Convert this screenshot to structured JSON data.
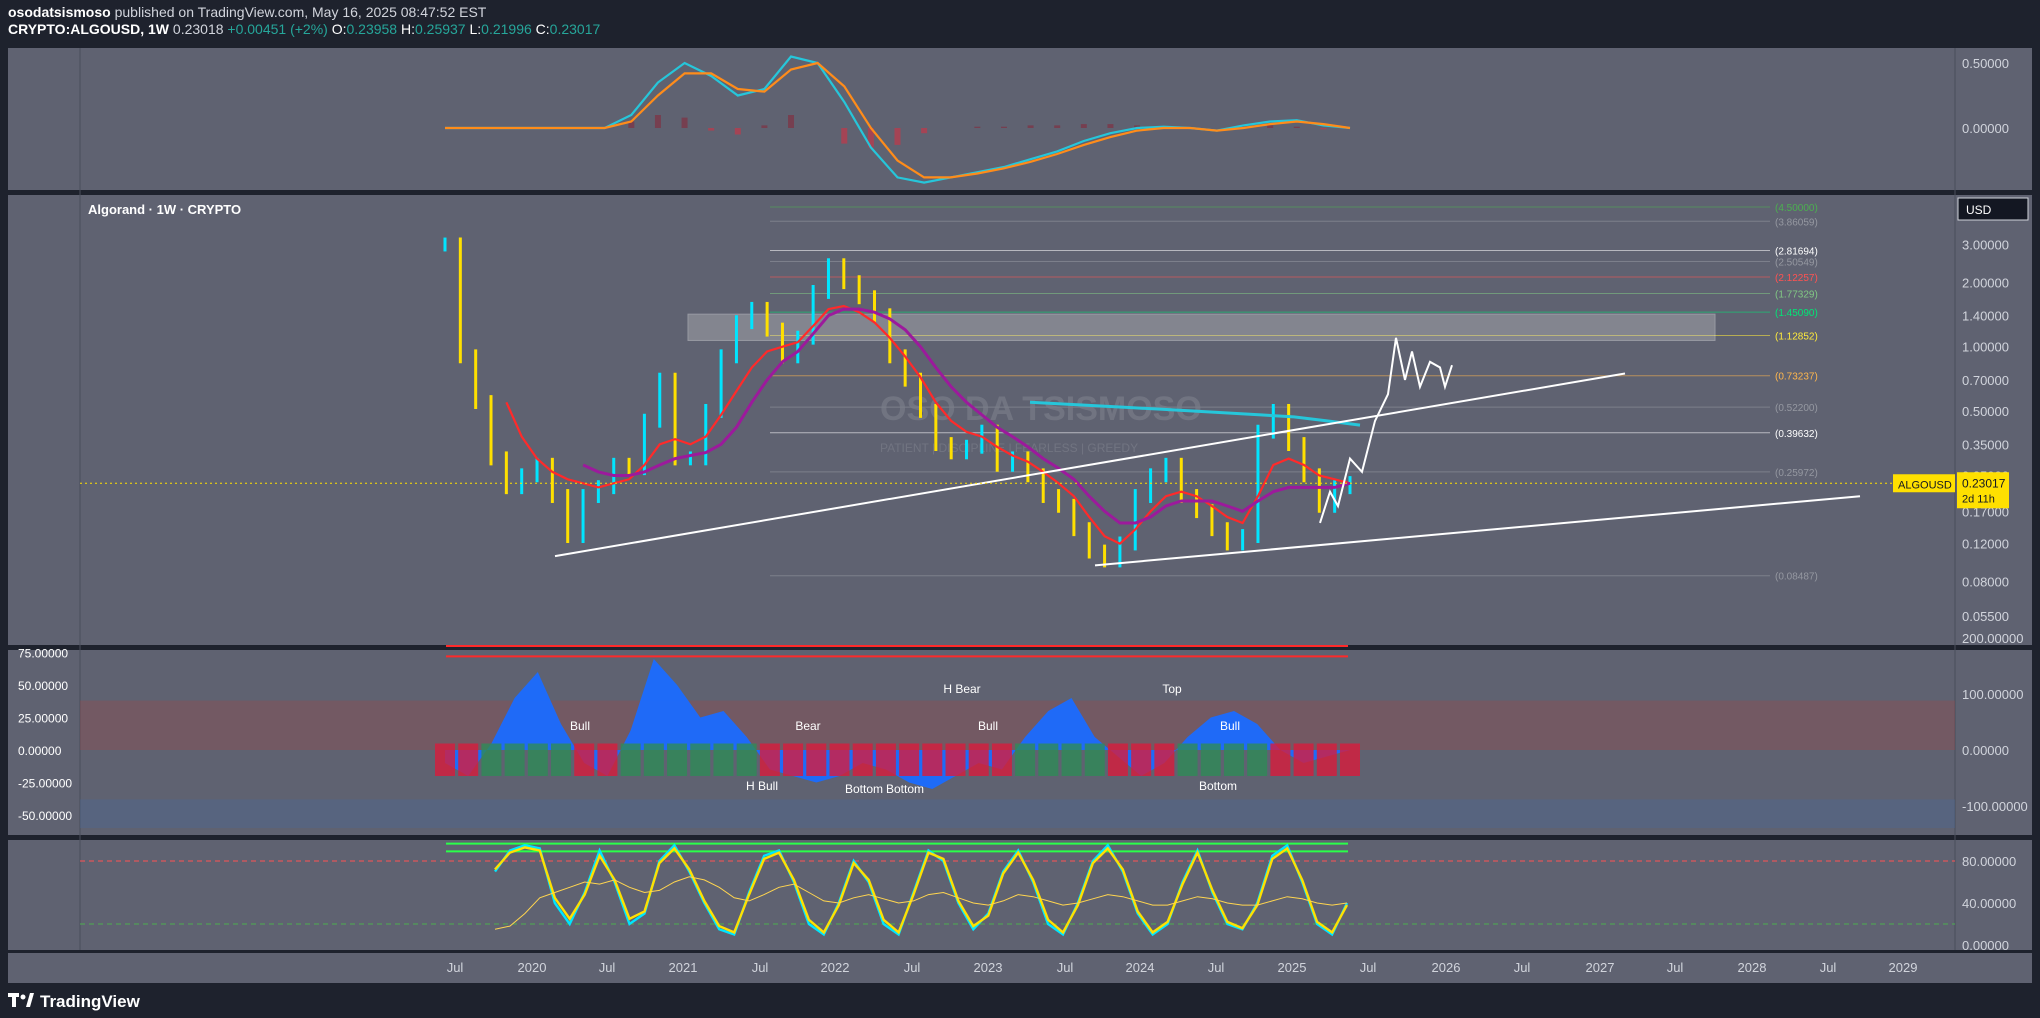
{
  "header": {
    "publisher": "osodatsismoso",
    "published_text": "published on TradingView.com, May 16, 2025 08:47:52 EST",
    "symbol_line": "CRYPTO:ALGOUSD, 1W",
    "last": "0.23018",
    "change": "+0.00451 (+2%)",
    "o_label": "O:",
    "o_value": "0.23958",
    "h_label": "H:",
    "h_value": "0.25937",
    "l_label": "L:",
    "l_value": "0.21996",
    "c_label": "C:",
    "c_value": "0.23017"
  },
  "footer": {
    "brand": "TradingView"
  },
  "colors": {
    "background": "#5f6271",
    "panel_border": "#1e222d",
    "price_up": "#00e5ff",
    "price_down": "#ffe000",
    "ema_red": "#ff2a2a",
    "ema_purple": "#9c1a9c",
    "macd_cyan": "#26c6da",
    "macd_orange": "#ff8c1a",
    "trendline": "#ffffff",
    "tag": "#ffe000"
  },
  "chart_data": [
    {
      "type": "line",
      "panel": "macd",
      "y_ticks": [
        "0.50000",
        "0.00000"
      ],
      "series": [
        {
          "color": "#26c6da",
          "values": [
            0,
            0,
            0,
            0,
            0,
            0,
            0,
            0.1,
            0.35,
            0.5,
            0.4,
            0.25,
            0.3,
            0.55,
            0.5,
            0.2,
            -0.15,
            -0.38,
            -0.42,
            -0.38,
            -0.34,
            -0.3,
            -0.24,
            -0.18,
            -0.1,
            -0.04,
            0,
            0.01,
            0.0,
            -0.02,
            0.02,
            0.05,
            0.06,
            0.02,
            0.0
          ]
        },
        {
          "color": "#ff8c1a",
          "values": [
            0,
            0,
            0,
            0,
            0,
            0,
            0,
            0.05,
            0.25,
            0.42,
            0.42,
            0.3,
            0.28,
            0.45,
            0.5,
            0.32,
            0.0,
            -0.25,
            -0.38,
            -0.38,
            -0.35,
            -0.31,
            -0.26,
            -0.2,
            -0.13,
            -0.07,
            -0.02,
            0.0,
            0.0,
            -0.02,
            0.0,
            0.03,
            0.05,
            0.03,
            0.0
          ]
        }
      ]
    },
    {
      "type": "line",
      "panel": "price",
      "title": "Algorand · 1W · CRYPTO",
      "y_scale": "log",
      "y_ticks": [
        "3.00000",
        "2.00000",
        "1.40000",
        "1.00000",
        "0.70000",
        "0.50000",
        "0.35000",
        "0.25000",
        "0.17000",
        "0.12000",
        "0.08000",
        "0.05500"
      ],
      "x_ticks": [
        "Jul",
        "2020",
        "Jul",
        "2021",
        "Jul",
        "2022",
        "Jul",
        "2023",
        "Jul",
        "2024",
        "Jul",
        "2025",
        "Jul",
        "2026",
        "Jul",
        "2027",
        "Jul",
        "2028",
        "Jul",
        "2029"
      ],
      "currency": "USD",
      "last_price_tag": {
        "symbol": "ALGOUSD",
        "value": "0.23017",
        "countdown": "2d 11h"
      },
      "fib_levels": [
        {
          "label": "(4.50000)",
          "value": 4.5,
          "color": "#4caf50"
        },
        {
          "label": "(3.86059)",
          "value": 3.86,
          "color": "#9598a1"
        },
        {
          "label": "(2.81694)",
          "value": 2.817,
          "color": "#ffffff"
        },
        {
          "label": "(2.50549)",
          "value": 2.505,
          "color": "#9598a1"
        },
        {
          "label": "(2.12257)",
          "value": 2.12,
          "color": "#ff5252"
        },
        {
          "label": "(1.77329)",
          "value": 1.773,
          "color": "#81c784"
        },
        {
          "label": "(1.45090)",
          "value": 1.451,
          "color": "#00e676"
        },
        {
          "label": "(1.12852)",
          "value": 1.1285,
          "color": "#ffeb3b"
        },
        {
          "label": "(0.73237)",
          "value": 0.732,
          "color": "#ffb74d"
        },
        {
          "label": "(0.52200)",
          "value": 0.522,
          "color": "#9598a1"
        },
        {
          "label": "(0.39632)",
          "value": 0.396,
          "color": "#ffffff"
        },
        {
          "label": "(0.25972)",
          "value": 0.26,
          "color": "#9598a1"
        },
        {
          "label": "(0.08487)",
          "value": 0.085,
          "color": "#9598a1"
        }
      ],
      "resistance_zone": {
        "low": 1.07,
        "high": 1.42
      },
      "watermark": "OSO DA TSISMOSO",
      "watermark_sub": "PATIENT | DISCIPLINE | FEARLESS | GREEDY",
      "series": [
        {
          "name": "",
          "kind": "price",
          "values": [
            3.0,
            0.9,
            0.55,
            0.3,
            0.22,
            0.25,
            0.28,
            0.2,
            0.13,
            0.2,
            0.22,
            0.28,
            0.27,
            0.45,
            0.7,
            0.3,
            0.3,
            0.5,
            0.9,
            1.3,
            1.5,
            1.2,
            0.9,
            1.1,
            1.8,
            2.4,
            2.0,
            1.7,
            1.4,
            0.9,
            0.7,
            0.5,
            0.35,
            0.32,
            0.34,
            0.4,
            0.28,
            0.3,
            0.25,
            0.2,
            0.18,
            0.14,
            0.11,
            0.1,
            0.12,
            0.2,
            0.25,
            0.28,
            0.2,
            0.17,
            0.14,
            0.12,
            0.13,
            0.4,
            0.5,
            0.35,
            0.25,
            0.18,
            0.22,
            0.23
          ]
        },
        {
          "name": "",
          "kind": "ema_red",
          "values": [
            null,
            null,
            null,
            null,
            0.55,
            0.38,
            0.3,
            0.26,
            0.24,
            0.23,
            0.22,
            0.23,
            0.24,
            0.28,
            0.35,
            0.37,
            0.35,
            0.38,
            0.48,
            0.62,
            0.8,
            0.95,
            1.0,
            1.05,
            1.25,
            1.5,
            1.55,
            1.45,
            1.3,
            1.1,
            0.9,
            0.72,
            0.55,
            0.45,
            0.4,
            0.38,
            0.34,
            0.31,
            0.29,
            0.26,
            0.23,
            0.2,
            0.16,
            0.13,
            0.12,
            0.14,
            0.17,
            0.2,
            0.21,
            0.2,
            0.18,
            0.16,
            0.15,
            0.2,
            0.28,
            0.3,
            0.28,
            0.25,
            0.24,
            0.23
          ]
        },
        {
          "name": "",
          "kind": "ema_purple",
          "values": [
            null,
            null,
            null,
            null,
            null,
            null,
            null,
            null,
            null,
            0.28,
            0.26,
            0.25,
            0.25,
            0.26,
            0.28,
            0.3,
            0.31,
            0.32,
            0.35,
            0.42,
            0.55,
            0.7,
            0.85,
            0.95,
            1.15,
            1.4,
            1.5,
            1.5,
            1.45,
            1.35,
            1.2,
            1.0,
            0.8,
            0.65,
            0.55,
            0.48,
            0.42,
            0.38,
            0.34,
            0.3,
            0.27,
            0.24,
            0.2,
            0.17,
            0.15,
            0.15,
            0.16,
            0.18,
            0.19,
            0.19,
            0.19,
            0.18,
            0.17,
            0.19,
            0.21,
            0.22,
            0.22,
            0.22,
            0.22,
            0.23
          ]
        },
        {
          "name": "",
          "kind": "ema_cyan",
          "values": [
            0.55,
            0.54,
            0.53,
            0.52,
            0.51,
            0.5,
            0.49,
            0.48,
            0.47,
            0.45,
            0.43
          ]
        }
      ]
    },
    {
      "type": "area",
      "panel": "oscillator",
      "y_ticks_left": [
        "75.00000",
        "50.00000",
        "25.00000",
        "0.00000",
        "-25.00000",
        "-50.00000"
      ],
      "y_ticks_right": [
        "200.00000",
        "100.00000",
        "0.00000",
        "-100.00000"
      ],
      "labels": [
        "Bull",
        "H Bull",
        "Bear",
        "Bottom",
        "Bottom",
        "H Bear",
        "Bull",
        "Top",
        "Bull",
        "Bottom"
      ],
      "values": [
        -10,
        -20,
        5,
        40,
        60,
        20,
        -10,
        -20,
        15,
        70,
        50,
        25,
        30,
        10,
        -15,
        -20,
        -25,
        -20,
        -10,
        -15,
        -25,
        -30,
        -20,
        -10,
        -15,
        10,
        30,
        40,
        10,
        -5,
        -20,
        -10,
        10,
        25,
        30,
        20,
        0,
        -10,
        -5,
        0
      ]
    },
    {
      "type": "line",
      "panel": "stoch_rsi",
      "y_ticks": [
        "80.00000",
        "40.00000",
        "0.00000"
      ],
      "levels": [
        80,
        20
      ],
      "series": [
        {
          "color": "#00e5ff",
          "values": [
            70,
            90,
            95,
            92,
            40,
            20,
            50,
            90,
            60,
            20,
            30,
            80,
            95,
            70,
            40,
            15,
            10,
            50,
            85,
            90,
            60,
            20,
            10,
            40,
            80,
            60,
            20,
            10,
            50,
            90,
            80,
            40,
            15,
            30,
            70,
            90,
            60,
            20,
            10,
            40,
            80,
            95,
            70,
            30,
            10,
            20,
            60,
            90,
            50,
            20,
            15,
            40,
            85,
            95,
            60,
            20,
            10,
            40
          ]
        },
        {
          "color": "#ffe000",
          "values": [
            72,
            88,
            93,
            90,
            45,
            25,
            48,
            85,
            62,
            25,
            32,
            78,
            92,
            72,
            42,
            18,
            12,
            48,
            82,
            88,
            62,
            24,
            12,
            38,
            78,
            62,
            24,
            12,
            48,
            88,
            82,
            42,
            18,
            28,
            68,
            88,
            62,
            24,
            12,
            38,
            78,
            92,
            72,
            32,
            12,
            22,
            58,
            88,
            52,
            22,
            16,
            38,
            82,
            92,
            62,
            22,
            12,
            38
          ]
        },
        {
          "color": "#ffd54f",
          "values": [
            15,
            18,
            30,
            45,
            50,
            55,
            60,
            58,
            62,
            55,
            50,
            52,
            60,
            65,
            62,
            55,
            45,
            42,
            48,
            55,
            58,
            50,
            42,
            40,
            45,
            48,
            44,
            40,
            42,
            48,
            50,
            45,
            40,
            38,
            42,
            48,
            46,
            42,
            38,
            40,
            44,
            48,
            46,
            42,
            38,
            38,
            42,
            46,
            44,
            40,
            38,
            38,
            42,
            46,
            44,
            40,
            38,
            40
          ]
        }
      ]
    }
  ]
}
